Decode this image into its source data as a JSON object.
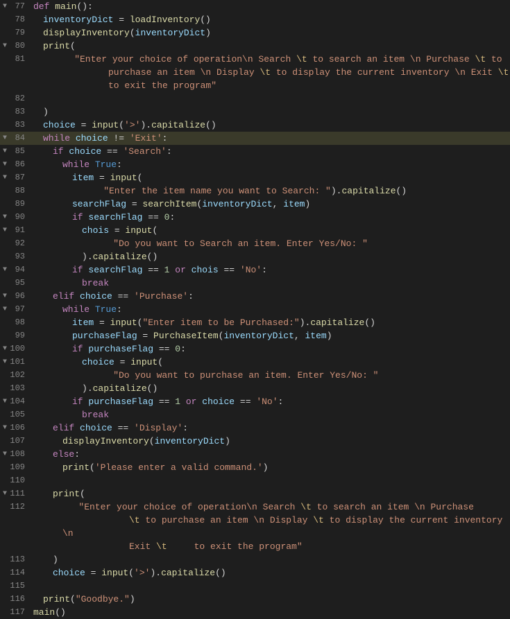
{
  "editor": {
    "background": "#1e1e1e",
    "lines": [
      {
        "num": 77,
        "fold": "▼",
        "indent": 0,
        "tokens": [
          {
            "t": "kw",
            "v": "def "
          },
          {
            "t": "fn",
            "v": "main"
          },
          {
            "t": "punct",
            "v": "():"
          }
        ]
      },
      {
        "num": 78,
        "fold": " ",
        "indent": 1,
        "tokens": [
          {
            "t": "var",
            "v": "inventoryDict"
          },
          {
            "t": "plain",
            "v": " = "
          },
          {
            "t": "fn",
            "v": "loadInventory"
          },
          {
            "t": "punct",
            "v": "()"
          }
        ]
      },
      {
        "num": 79,
        "fold": " ",
        "indent": 1,
        "tokens": [
          {
            "t": "fn",
            "v": "displayInventory"
          },
          {
            "t": "punct",
            "v": "("
          },
          {
            "t": "var",
            "v": "inventoryDict"
          },
          {
            "t": "punct",
            "v": ")"
          }
        ]
      },
      {
        "num": 80,
        "fold": "▼",
        "indent": 1,
        "tokens": [
          {
            "t": "fn",
            "v": "print"
          },
          {
            "t": "punct",
            "v": "("
          }
        ]
      },
      {
        "num": 81,
        "fold": " ",
        "indent": 2,
        "tokens": [
          {
            "t": "str",
            "v": "\"Enter your choice of operation\\n Search "
          },
          {
            "t": "escape",
            "v": "\\t"
          },
          {
            "t": "str",
            "v": " to search an item \\n Purchase "
          },
          {
            "t": "escape",
            "v": "\\t"
          },
          {
            "t": "str",
            "v": " to"
          },
          {
            "t": "nl",
            "v": ""
          },
          {
            "t": "str",
            "v": "purchase an item \\n Display "
          },
          {
            "t": "escape",
            "v": "\\t"
          },
          {
            "t": "str",
            "v": " to display the current inventory \\n Exit "
          },
          {
            "t": "escape",
            "v": "\\t"
          },
          {
            "t": "nl",
            "v": ""
          },
          {
            "t": "str",
            "v": "to exit the program\""
          }
        ]
      },
      {
        "num": 82,
        "fold": " ",
        "indent": 0,
        "tokens": []
      },
      {
        "num": 83,
        "fold": " ",
        "indent": 1,
        "tokens": [
          {
            "t": "punct",
            "v": ")"
          }
        ]
      },
      {
        "num": 83,
        "fold": " ",
        "indent": 1,
        "tokens": [
          {
            "t": "var",
            "v": "choice"
          },
          {
            "t": "plain",
            "v": " = "
          },
          {
            "t": "fn",
            "v": "input"
          },
          {
            "t": "punct",
            "v": "("
          },
          {
            "t": "str",
            "v": "'>'"
          },
          {
            "t": "punct",
            "v": ")"
          },
          {
            "t": "plain",
            "v": "."
          },
          {
            "t": "fn",
            "v": "capitalize"
          },
          {
            "t": "punct",
            "v": "()"
          }
        ]
      },
      {
        "num": 84,
        "fold": "▼",
        "indent": 1,
        "tokens": [
          {
            "t": "kw",
            "v": "while "
          },
          {
            "t": "var",
            "v": "choice"
          },
          {
            "t": "plain",
            "v": " != "
          },
          {
            "t": "str",
            "v": "'Exit'"
          },
          {
            "t": "punct",
            "v": ":"
          }
        ],
        "highlighted": true
      },
      {
        "num": 85,
        "fold": "▼",
        "indent": 2,
        "tokens": [
          {
            "t": "kw",
            "v": "if "
          },
          {
            "t": "var",
            "v": "choice"
          },
          {
            "t": "plain",
            "v": " == "
          },
          {
            "t": "str",
            "v": "'Search'"
          },
          {
            "t": "punct",
            "v": ":"
          }
        ]
      },
      {
        "num": 86,
        "fold": "▼",
        "indent": 3,
        "tokens": [
          {
            "t": "kw",
            "v": "while "
          },
          {
            "t": "kw2",
            "v": "True"
          },
          {
            "t": "punct",
            "v": ":"
          }
        ]
      },
      {
        "num": 87,
        "fold": "▼",
        "indent": 4,
        "tokens": [
          {
            "t": "var",
            "v": "item"
          },
          {
            "t": "plain",
            "v": " = "
          },
          {
            "t": "fn",
            "v": "input"
          },
          {
            "t": "punct",
            "v": "("
          }
        ]
      },
      {
        "num": 88,
        "fold": " ",
        "indent": 5,
        "tokens": [
          {
            "t": "str",
            "v": "\"Enter the item name you want to Search: \""
          },
          {
            "t": "punct",
            "v": ")"
          },
          {
            "t": "plain",
            "v": "."
          },
          {
            "t": "fn",
            "v": "capitalize"
          },
          {
            "t": "punct",
            "v": "()"
          }
        ]
      },
      {
        "num": 89,
        "fold": " ",
        "indent": 4,
        "tokens": [
          {
            "t": "var",
            "v": "searchFlag"
          },
          {
            "t": "plain",
            "v": " = "
          },
          {
            "t": "fn",
            "v": "searchItem"
          },
          {
            "t": "punct",
            "v": "("
          },
          {
            "t": "var",
            "v": "inventoryDict"
          },
          {
            "t": "plain",
            "v": ", "
          },
          {
            "t": "var",
            "v": "item"
          },
          {
            "t": "punct",
            "v": ")"
          }
        ]
      },
      {
        "num": 90,
        "fold": "▼",
        "indent": 4,
        "tokens": [
          {
            "t": "kw",
            "v": "if "
          },
          {
            "t": "var",
            "v": "searchFlag"
          },
          {
            "t": "plain",
            "v": " == "
          },
          {
            "t": "num",
            "v": "0"
          },
          {
            "t": "punct",
            "v": ":"
          }
        ]
      },
      {
        "num": 91,
        "fold": "▼",
        "indent": 5,
        "tokens": [
          {
            "t": "var",
            "v": "chois"
          },
          {
            "t": "plain",
            "v": " = "
          },
          {
            "t": "fn",
            "v": "input"
          },
          {
            "t": "punct",
            "v": "("
          }
        ]
      },
      {
        "num": 92,
        "fold": " ",
        "indent": 6,
        "tokens": [
          {
            "t": "str",
            "v": "\"Do you want to Search an item. Enter Yes/No: \""
          }
        ]
      },
      {
        "num": 93,
        "fold": " ",
        "indent": 5,
        "tokens": [
          {
            "t": "punct",
            "v": ")"
          },
          {
            "t": "plain",
            "v": "."
          },
          {
            "t": "fn",
            "v": "capitalize"
          },
          {
            "t": "punct",
            "v": "()"
          }
        ]
      },
      {
        "num": 94,
        "fold": "▼",
        "indent": 4,
        "tokens": [
          {
            "t": "kw",
            "v": "if "
          },
          {
            "t": "var",
            "v": "searchFlag"
          },
          {
            "t": "plain",
            "v": " == "
          },
          {
            "t": "num",
            "v": "1"
          },
          {
            "t": "plain",
            "v": " "
          },
          {
            "t": "kw",
            "v": "or "
          },
          {
            "t": "var",
            "v": "chois"
          },
          {
            "t": "plain",
            "v": " == "
          },
          {
            "t": "str",
            "v": "'No'"
          },
          {
            "t": "punct",
            "v": ":"
          }
        ]
      },
      {
        "num": 95,
        "fold": " ",
        "indent": 5,
        "tokens": [
          {
            "t": "kw",
            "v": "break"
          }
        ]
      },
      {
        "num": 96,
        "fold": "▼",
        "indent": 2,
        "tokens": [
          {
            "t": "kw",
            "v": "elif "
          },
          {
            "t": "var",
            "v": "choice"
          },
          {
            "t": "plain",
            "v": " == "
          },
          {
            "t": "str",
            "v": "'Purchase'"
          },
          {
            "t": "punct",
            "v": ":"
          }
        ]
      },
      {
        "num": 97,
        "fold": "▼",
        "indent": 3,
        "tokens": [
          {
            "t": "kw",
            "v": "while "
          },
          {
            "t": "kw2",
            "v": "True"
          },
          {
            "t": "punct",
            "v": ":"
          }
        ]
      },
      {
        "num": 98,
        "fold": " ",
        "indent": 4,
        "tokens": [
          {
            "t": "var",
            "v": "item"
          },
          {
            "t": "plain",
            "v": " = "
          },
          {
            "t": "fn",
            "v": "input"
          },
          {
            "t": "punct",
            "v": "("
          },
          {
            "t": "str",
            "v": "\"Enter item to be Purchased:\""
          },
          {
            "t": "punct",
            "v": ")"
          },
          {
            "t": "plain",
            "v": "."
          },
          {
            "t": "fn",
            "v": "capitalize"
          },
          {
            "t": "punct",
            "v": "()"
          }
        ]
      },
      {
        "num": 99,
        "fold": " ",
        "indent": 4,
        "tokens": [
          {
            "t": "var",
            "v": "purchaseFlag"
          },
          {
            "t": "plain",
            "v": " = "
          },
          {
            "t": "fn",
            "v": "PurchaseItem"
          },
          {
            "t": "punct",
            "v": "("
          },
          {
            "t": "var",
            "v": "inventoryDict"
          },
          {
            "t": "plain",
            "v": ", "
          },
          {
            "t": "var",
            "v": "item"
          },
          {
            "t": "punct",
            "v": ")"
          }
        ]
      },
      {
        "num": 100,
        "fold": "▼",
        "indent": 4,
        "tokens": [
          {
            "t": "kw",
            "v": "if "
          },
          {
            "t": "var",
            "v": "purchaseFlag"
          },
          {
            "t": "plain",
            "v": " == "
          },
          {
            "t": "num",
            "v": "0"
          },
          {
            "t": "punct",
            "v": ":"
          }
        ]
      },
      {
        "num": 101,
        "fold": "▼",
        "indent": 5,
        "tokens": [
          {
            "t": "var",
            "v": "choice"
          },
          {
            "t": "plain",
            "v": " = "
          },
          {
            "t": "fn",
            "v": "input"
          },
          {
            "t": "punct",
            "v": "("
          }
        ]
      },
      {
        "num": 102,
        "fold": " ",
        "indent": 6,
        "tokens": [
          {
            "t": "str",
            "v": "\"Do you want to purchase an item. Enter Yes/No: \""
          }
        ]
      },
      {
        "num": 103,
        "fold": " ",
        "indent": 5,
        "tokens": [
          {
            "t": "punct",
            "v": ")"
          },
          {
            "t": "plain",
            "v": "."
          },
          {
            "t": "fn",
            "v": "capitalize"
          },
          {
            "t": "punct",
            "v": "()"
          }
        ]
      },
      {
        "num": 104,
        "fold": "▼",
        "indent": 4,
        "tokens": [
          {
            "t": "kw",
            "v": "if "
          },
          {
            "t": "var",
            "v": "purchaseFlag"
          },
          {
            "t": "plain",
            "v": " == "
          },
          {
            "t": "num",
            "v": "1"
          },
          {
            "t": "plain",
            "v": " "
          },
          {
            "t": "kw",
            "v": "or "
          },
          {
            "t": "var",
            "v": "choice"
          },
          {
            "t": "plain",
            "v": " == "
          },
          {
            "t": "str",
            "v": "'No'"
          },
          {
            "t": "punct",
            "v": ":"
          }
        ]
      },
      {
        "num": 105,
        "fold": " ",
        "indent": 5,
        "tokens": [
          {
            "t": "kw",
            "v": "break"
          }
        ]
      },
      {
        "num": 106,
        "fold": "▼",
        "indent": 2,
        "tokens": [
          {
            "t": "kw",
            "v": "elif "
          },
          {
            "t": "var",
            "v": "choice"
          },
          {
            "t": "plain",
            "v": " == "
          },
          {
            "t": "str",
            "v": "'Display'"
          },
          {
            "t": "punct",
            "v": ":"
          }
        ]
      },
      {
        "num": 107,
        "fold": " ",
        "indent": 3,
        "tokens": [
          {
            "t": "fn",
            "v": "displayInventory"
          },
          {
            "t": "punct",
            "v": "("
          },
          {
            "t": "var",
            "v": "inventoryDict"
          },
          {
            "t": "punct",
            "v": ")"
          }
        ]
      },
      {
        "num": 108,
        "fold": "▼",
        "indent": 2,
        "tokens": [
          {
            "t": "kw",
            "v": "else"
          },
          {
            "t": "punct",
            "v": ":"
          }
        ]
      },
      {
        "num": 109,
        "fold": " ",
        "indent": 3,
        "tokens": [
          {
            "t": "fn",
            "v": "print"
          },
          {
            "t": "punct",
            "v": "("
          },
          {
            "t": "str",
            "v": "'Please enter a valid command.'"
          },
          {
            "t": "punct",
            "v": ")"
          }
        ]
      },
      {
        "num": 110,
        "fold": " ",
        "indent": 0,
        "tokens": []
      },
      {
        "num": 111,
        "fold": "▼",
        "indent": 2,
        "tokens": [
          {
            "t": "fn",
            "v": "print"
          },
          {
            "t": "punct",
            "v": "("
          }
        ]
      },
      {
        "num": 112,
        "fold": " ",
        "indent": 3,
        "tokens": [
          {
            "t": "str",
            "v": "\"Enter your choice of operation\\n Search "
          },
          {
            "t": "escape",
            "v": "\\t"
          },
          {
            "t": "str",
            "v": " to search an item \\n Purchase"
          },
          {
            "t": "nl",
            "v": ""
          },
          {
            "t": "escape",
            "v": "\\t"
          },
          {
            "t": "str",
            "v": " to purchase an item \\n Display "
          },
          {
            "t": "escape",
            "v": "\\t"
          },
          {
            "t": "str",
            "v": " to display the current inventory \\n"
          },
          {
            "t": "nl",
            "v": ""
          },
          {
            "t": "str",
            "v": "Exit "
          },
          {
            "t": "escape",
            "v": "\\t"
          },
          {
            "t": "str",
            "v": "      to exit the program\""
          }
        ]
      },
      {
        "num": 113,
        "fold": " ",
        "indent": 2,
        "tokens": [
          {
            "t": "punct",
            "v": ")"
          }
        ]
      },
      {
        "num": 114,
        "fold": " ",
        "indent": 2,
        "tokens": [
          {
            "t": "var",
            "v": "choice"
          },
          {
            "t": "plain",
            "v": " = "
          },
          {
            "t": "fn",
            "v": "input"
          },
          {
            "t": "punct",
            "v": "("
          },
          {
            "t": "str",
            "v": "'>'"
          },
          {
            "t": "punct",
            "v": ")"
          },
          {
            "t": "plain",
            "v": "."
          },
          {
            "t": "fn",
            "v": "capitalize"
          },
          {
            "t": "punct",
            "v": "()"
          }
        ]
      },
      {
        "num": 115,
        "fold": " ",
        "indent": 0,
        "tokens": []
      },
      {
        "num": 116,
        "fold": " ",
        "indent": 1,
        "tokens": [
          {
            "t": "fn",
            "v": "print"
          },
          {
            "t": "punct",
            "v": "("
          },
          {
            "t": "str",
            "v": "\"Goodbye.\""
          },
          {
            "t": "punct",
            "v": ")"
          }
        ]
      },
      {
        "num": 117,
        "fold": " ",
        "indent": 0,
        "tokens": [
          {
            "t": "fn",
            "v": "main"
          },
          {
            "t": "punct",
            "v": "()"
          }
        ]
      }
    ]
  }
}
